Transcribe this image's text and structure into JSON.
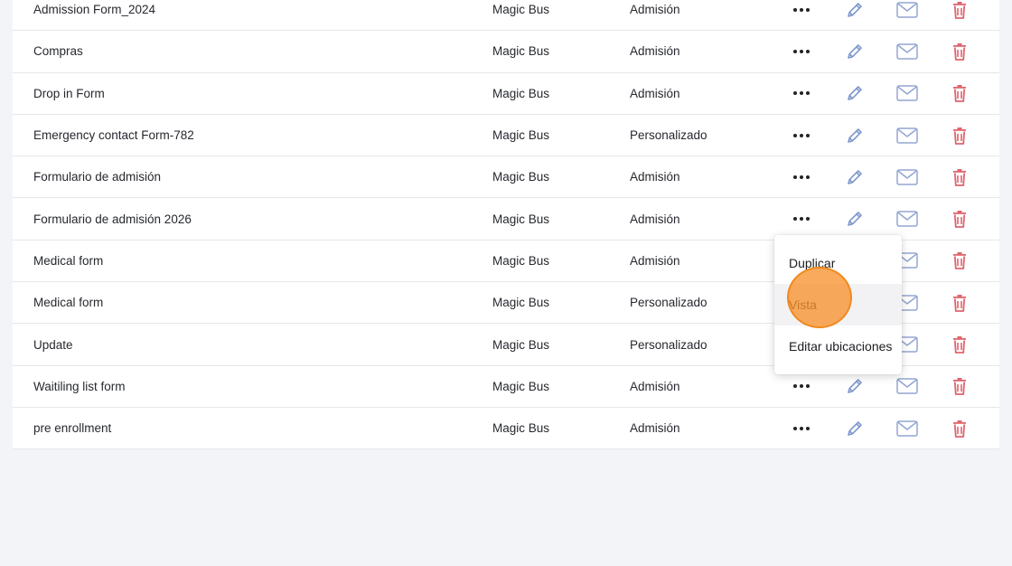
{
  "rows": [
    {
      "name": "Admission Form_2024",
      "org": "Magic Bus",
      "type": "Admisión"
    },
    {
      "name": "Compras",
      "org": "Magic Bus",
      "type": "Admisión"
    },
    {
      "name": "Drop in Form",
      "org": "Magic Bus",
      "type": "Admisión"
    },
    {
      "name": "Emergency contact Form-782",
      "org": "Magic Bus",
      "type": "Personalizado"
    },
    {
      "name": "Formulario de admisión",
      "org": "Magic Bus",
      "type": "Admisión"
    },
    {
      "name": "Formulario de admisión 2026",
      "org": "Magic Bus",
      "type": "Admisión"
    },
    {
      "name": "Medical form",
      "org": "Magic Bus",
      "type": "Admisión"
    },
    {
      "name": "Medical form",
      "org": "Magic Bus",
      "type": "Personalizado"
    },
    {
      "name": "Update",
      "org": "Magic Bus",
      "type": "Personalizado"
    },
    {
      "name": "Waitiling list form",
      "org": "Magic Bus",
      "type": "Admisión"
    },
    {
      "name": "pre enrollment",
      "org": "Magic Bus",
      "type": "Admisión"
    }
  ],
  "row_actions": {
    "more_icon": "more-horizontal-icon",
    "edit_icon": "pencil-icon",
    "mail_icon": "envelope-icon",
    "delete_icon": "trash-icon"
  },
  "context_menu": {
    "items": [
      {
        "label": "Duplicar"
      },
      {
        "label": "Vista"
      },
      {
        "label": "Editar ubicaciones"
      }
    ],
    "hovered_index": 1
  },
  "colors": {
    "edit": "#7d96cc",
    "mail": "#93a5d2",
    "delete": "#e0646e",
    "highlight": "#f7922e"
  }
}
